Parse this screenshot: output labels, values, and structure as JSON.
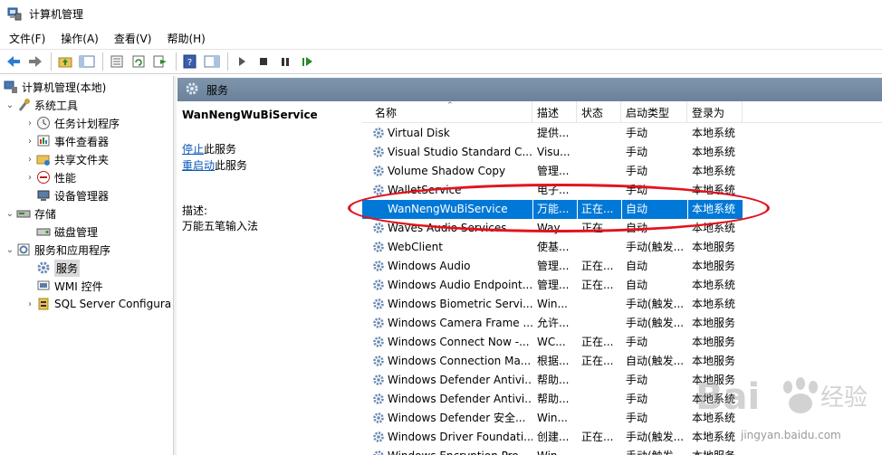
{
  "window": {
    "title": "计算机管理"
  },
  "menu": [
    "文件(F)",
    "操作(A)",
    "查看(V)",
    "帮助(H)"
  ],
  "toolbar": {
    "buttons": [
      "back-icon",
      "forward-icon",
      "up-folder-icon",
      "show-hide-tree-icon",
      "properties-icon",
      "refresh-icon",
      "export-icon",
      "help-icon",
      "action-pane-icon",
      "play-icon",
      "stop-icon",
      "pause-icon",
      "resume-icon"
    ]
  },
  "tree": {
    "root": "计算机管理(本地)",
    "system_tools": "系统工具",
    "task_scheduler": "任务计划程序",
    "event_viewer": "事件查看器",
    "shared_folders": "共享文件夹",
    "performance": "性能",
    "device_manager": "设备管理器",
    "storage": "存储",
    "disk_management": "磁盘管理",
    "services_apps": "服务和应用程序",
    "services": "服务",
    "wmi": "WMI 控件",
    "sql_server": "SQL Server Configura"
  },
  "panel": {
    "title": "服务"
  },
  "detail": {
    "service_name": "WanNengWuBiService",
    "stop_link": "停止",
    "stop_suffix": "此服务",
    "restart_link": "重启动",
    "restart_suffix": "此服务",
    "desc_label": "描述:",
    "desc_value": "万能五笔输入法"
  },
  "columns": {
    "name": "名称",
    "desc": "描述",
    "status": "状态",
    "startup": "启动类型",
    "logon": "登录为"
  },
  "services": [
    {
      "name": "Virtual Disk",
      "desc": "提供...",
      "status": "",
      "startup": "手动",
      "logon": "本地系统"
    },
    {
      "name": "Visual Studio Standard C...",
      "desc": "Visu...",
      "status": "",
      "startup": "手动",
      "logon": "本地系统"
    },
    {
      "name": "Volume Shadow Copy",
      "desc": "管理...",
      "status": "",
      "startup": "手动",
      "logon": "本地系统"
    },
    {
      "name": "WalletService",
      "desc": "电子...",
      "status": "",
      "startup": "手动",
      "logon": "本地系统"
    },
    {
      "name": "WanNengWuBiService",
      "desc": "万能...",
      "status": "正在...",
      "startup": "自动",
      "logon": "本地系统"
    },
    {
      "name": "Waves Audio Services",
      "desc": "Way...",
      "status": "正在...",
      "startup": "自动",
      "logon": "本地系统"
    },
    {
      "name": "WebClient",
      "desc": "使基...",
      "status": "",
      "startup": "手动(触发...",
      "logon": "本地服务"
    },
    {
      "name": "Windows Audio",
      "desc": "管理...",
      "status": "正在...",
      "startup": "自动",
      "logon": "本地服务"
    },
    {
      "name": "Windows Audio Endpoint...",
      "desc": "管理...",
      "status": "正在...",
      "startup": "自动",
      "logon": "本地系统"
    },
    {
      "name": "Windows Biometric Servi...",
      "desc": "Win...",
      "status": "",
      "startup": "手动(触发...",
      "logon": "本地系统"
    },
    {
      "name": "Windows Camera Frame ...",
      "desc": "允许...",
      "status": "",
      "startup": "手动(触发...",
      "logon": "本地服务"
    },
    {
      "name": "Windows Connect Now -...",
      "desc": "WC...",
      "status": "正在...",
      "startup": "手动",
      "logon": "本地服务"
    },
    {
      "name": "Windows Connection Ma...",
      "desc": "根据...",
      "status": "正在...",
      "startup": "自动(触发...",
      "logon": "本地服务"
    },
    {
      "name": "Windows Defender Antivi...",
      "desc": "帮助...",
      "status": "",
      "startup": "手动",
      "logon": "本地服务"
    },
    {
      "name": "Windows Defender Antivi...",
      "desc": "帮助...",
      "status": "",
      "startup": "手动",
      "logon": "本地系统"
    },
    {
      "name": "Windows Defender 安全...",
      "desc": "Win...",
      "status": "",
      "startup": "手动",
      "logon": "本地系统"
    },
    {
      "name": "Windows Driver Foundati...",
      "desc": "创建...",
      "status": "正在...",
      "startup": "手动(触发...",
      "logon": "本地系统"
    },
    {
      "name": "Windows Encryption Pro...",
      "desc": "Win...",
      "status": "",
      "startup": "手动(触发...",
      "logon": "本地服务"
    }
  ],
  "selected_service": "WanNengWuBiService",
  "colors": {
    "selection": "#0078d7",
    "annotation": "#e0141e",
    "link": "#0b58b8"
  },
  "watermark": {
    "text": "jingyan.baidu.com",
    "brand": "Bai",
    "brand_suffix": "经验"
  }
}
